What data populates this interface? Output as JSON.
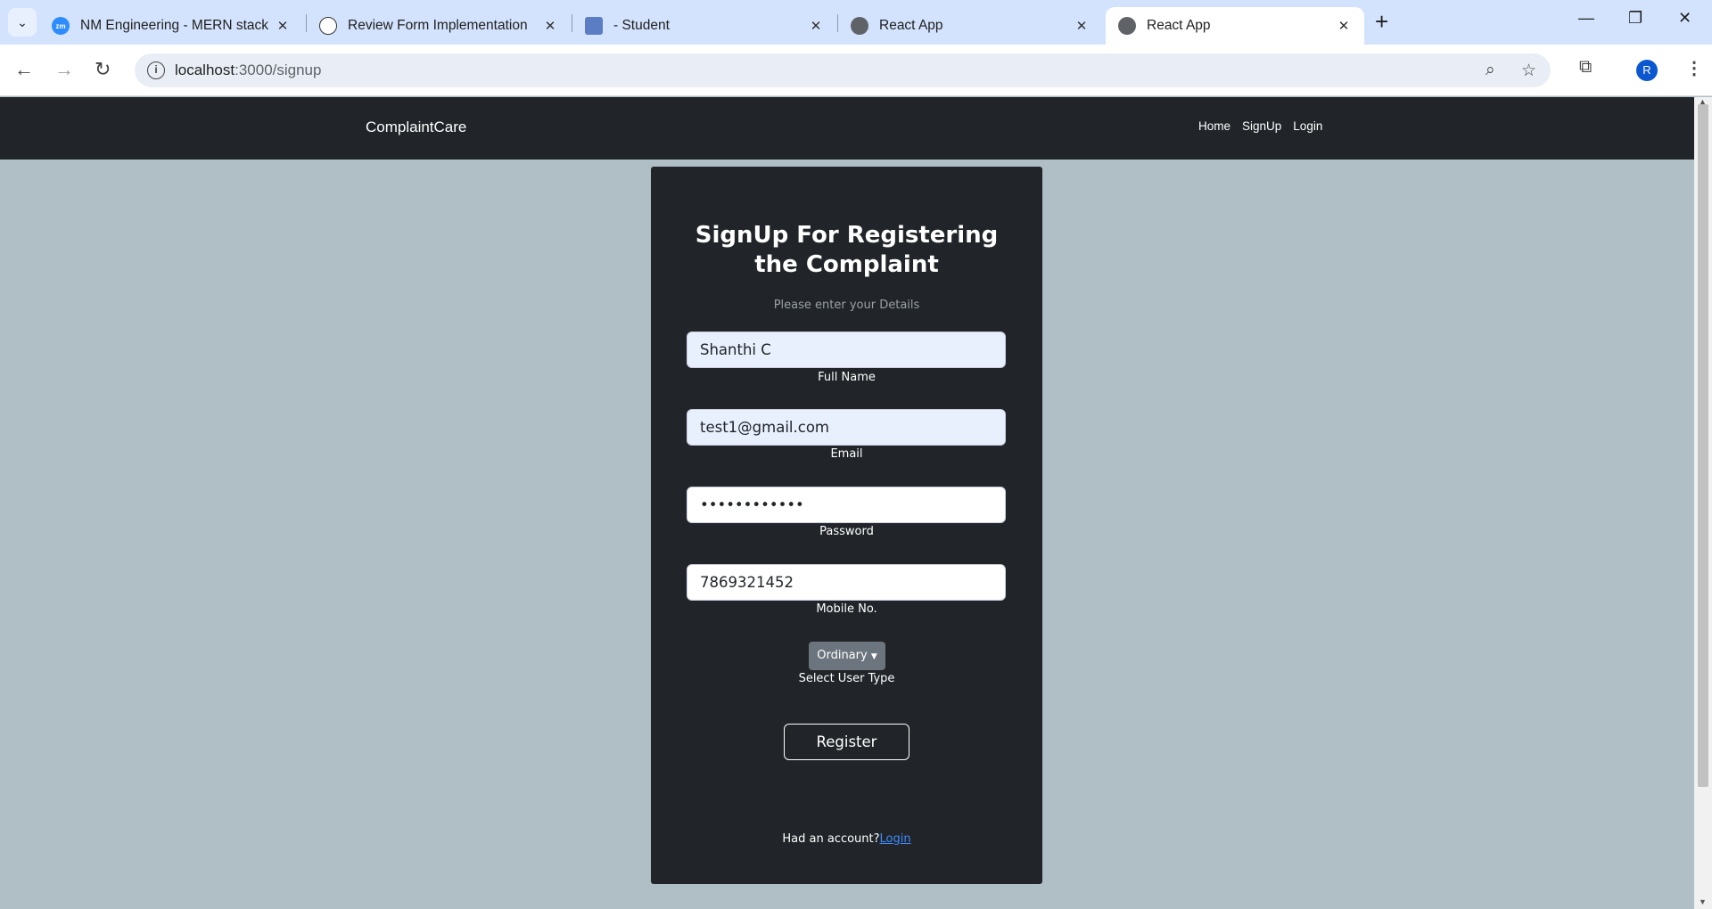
{
  "browser": {
    "tabs": [
      {
        "title": "NM Engineering - MERN stack",
        "icon": "zoom-icon"
      },
      {
        "title": "Review Form Implementation",
        "icon": "chatgpt-icon"
      },
      {
        "title": "- Student",
        "icon": "student-icon"
      },
      {
        "title": "React App",
        "icon": "globe-icon"
      },
      {
        "title": "React App",
        "icon": "globe-icon",
        "active": true
      }
    ],
    "url_host": "localhost",
    "url_path": ":3000/signup",
    "profile_initial": "R"
  },
  "navbar": {
    "brand": "ComplaintCare",
    "links": [
      "Home",
      "SignUp",
      "Login"
    ]
  },
  "form": {
    "title": "SignUp For Registering the Complaint",
    "subtitle": "Please enter your Details",
    "full_name": {
      "value": "Shanthi C",
      "label": "Full Name"
    },
    "email": {
      "value": "test1@gmail.com",
      "label": "Email"
    },
    "password": {
      "value": "••••••••••••",
      "label": "Password"
    },
    "mobile": {
      "value": "7869321452",
      "label": "Mobile No."
    },
    "user_type": {
      "selected": "Ordinary",
      "label": "Select User Type"
    },
    "register_label": "Register",
    "footer_text": "Had an account?",
    "footer_link": "Login"
  }
}
